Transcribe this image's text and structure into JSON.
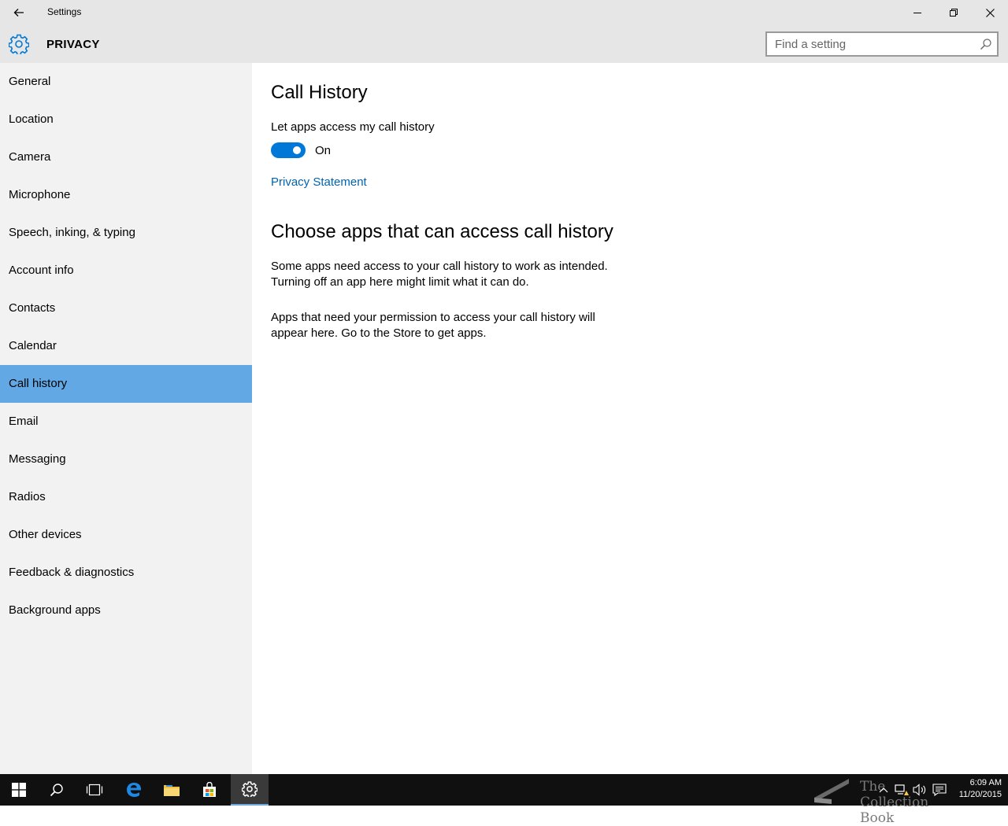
{
  "window": {
    "title": "Settings"
  },
  "header": {
    "section": "PRIVACY",
    "search_placeholder": "Find a setting"
  },
  "sidebar": {
    "items": [
      {
        "label": "General"
      },
      {
        "label": "Location"
      },
      {
        "label": "Camera"
      },
      {
        "label": "Microphone"
      },
      {
        "label": "Speech, inking, & typing"
      },
      {
        "label": "Account info"
      },
      {
        "label": "Contacts"
      },
      {
        "label": "Calendar"
      },
      {
        "label": "Call history"
      },
      {
        "label": "Email"
      },
      {
        "label": "Messaging"
      },
      {
        "label": "Radios"
      },
      {
        "label": "Other devices"
      },
      {
        "label": "Feedback & diagnostics"
      },
      {
        "label": "Background apps"
      }
    ],
    "selected": "Call history"
  },
  "main": {
    "title": "Call History",
    "toggle_label": "Let apps access my call history",
    "toggle_state": "On",
    "privacy_link": "Privacy Statement",
    "section_title": "Choose apps that can access call history",
    "para1": "Some apps need access to your call history to work as intended. Turning off an app here might limit what it can do.",
    "para2": "Apps that need your permission to access your call history will appear here. Go to the Store to get apps."
  },
  "taskbar": {
    "watermark": "The Collection Book",
    "time": "6:09 AM",
    "date": "11/20/2015"
  },
  "colors": {
    "accent": "#0078d7",
    "selected_nav": "#62a8e5",
    "link": "#0063b1"
  }
}
